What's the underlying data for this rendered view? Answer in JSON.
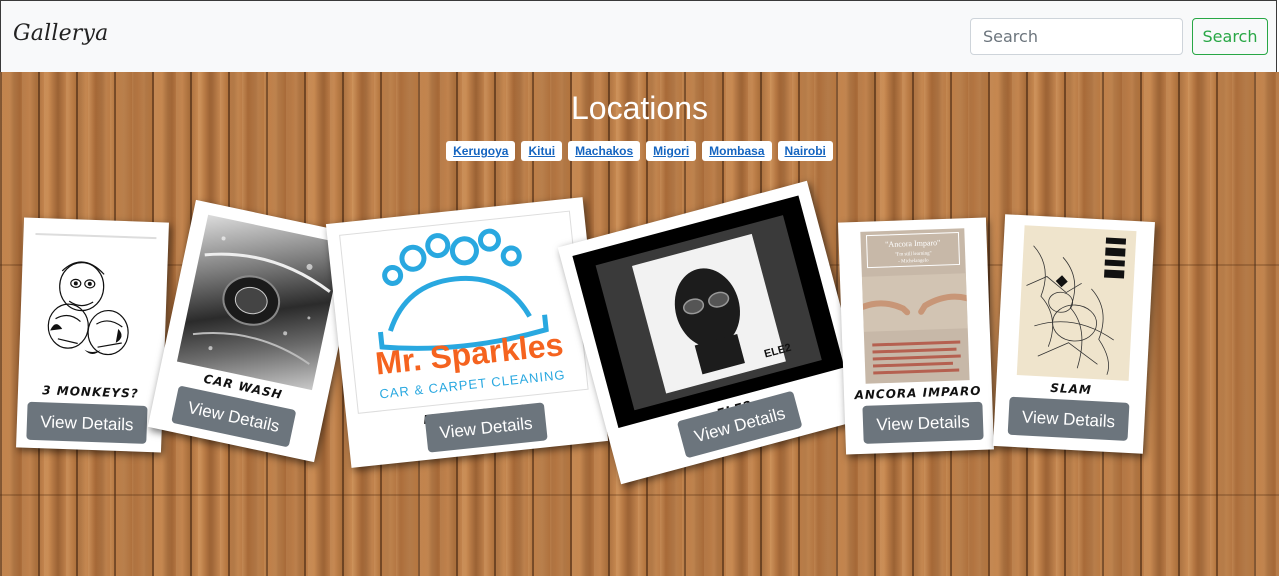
{
  "navbar": {
    "brand": "Gallerya",
    "search_placeholder": "Search",
    "search_button": "Search"
  },
  "page": {
    "title": "Locations"
  },
  "locations": [
    "Kerugoya",
    "Kitui",
    "Machakos",
    "Migori",
    "Mombasa",
    "Nairobi"
  ],
  "cards": [
    {
      "caption": "3 monkeys?",
      "button": "View Details"
    },
    {
      "caption": "car wash",
      "button": "View Details"
    },
    {
      "caption": "Mr sparkles",
      "button": "View Details",
      "logo_line1": "Mr. Sparkles",
      "logo_line2": "CAR & CARPET CLEANING"
    },
    {
      "caption": "ELE2",
      "button": "View Details",
      "cover_text": "ELE2"
    },
    {
      "caption": "Ancora imparo",
      "button": "View Details",
      "poster_title": "\"Ancora Imparo\"",
      "poster_sub": "\"I'm still learning\"",
      "poster_author": "- Michelangelo"
    },
    {
      "caption": "SLAM",
      "button": "View Details"
    }
  ],
  "colors": {
    "accent_green": "#28a745",
    "button_gray": "#6c757d",
    "link_blue": "#1565c0",
    "sparkles_orange": "#f5631f",
    "sparkles_blue": "#29a8e0"
  }
}
